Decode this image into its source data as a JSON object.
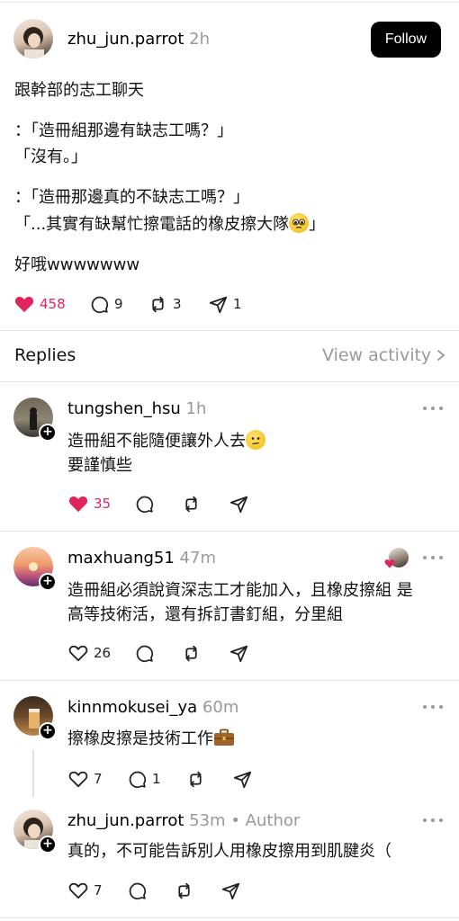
{
  "post": {
    "username": "zhu_jun.parrot",
    "time": "2h",
    "follow_label": "Follow",
    "lines": [
      "跟幹部的志工聊天",
      "：「造冊組那邊有缺志工嗎？」",
      "「沒有。」",
      "：「造冊那邊真的不缺志工嗎？」",
      "「...其實有缺幫忙擦電話的橡皮擦大隊",
      "」",
      "好哦wwwwwww"
    ],
    "likes": "458",
    "comments": "9",
    "reposts": "3",
    "shares": "1"
  },
  "replies_header": {
    "title": "Replies",
    "view_activity": "View activity"
  },
  "replies": [
    {
      "username": "tungshen_hsu",
      "time": "1h",
      "lines": [
        "造冊組不能隨便讓外人去",
        "要謹慎些"
      ],
      "likes": "35"
    },
    {
      "username": "maxhuang51",
      "time": "47m",
      "lines": [
        "造冊組必須說資深志工才能加入，且橡皮擦組 是",
        "高等技術活，還有拆訂書釘組，分里組"
      ],
      "likes": "26"
    },
    {
      "username": "kinnmokusei_ya",
      "time": "60m",
      "lines": [
        "擦橡皮擦是技術工作"
      ],
      "likes": "7",
      "comments": "1"
    },
    {
      "username": "zhu_jun.parrot",
      "time": "53m",
      "author": "• Author",
      "lines": [
        "真的，不可能告訴別人用橡皮擦用到肌腱炎（"
      ],
      "likes": "7"
    }
  ],
  "colors": {
    "like_red": "#e0245e",
    "muted": "#999999",
    "follow_bg": "#000000"
  }
}
